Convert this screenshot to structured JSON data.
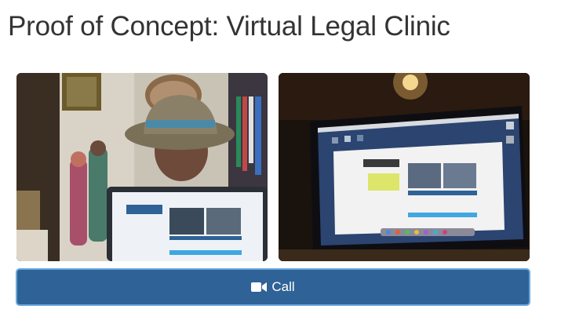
{
  "header": {
    "title": "Proof of Concept: Virtual Legal Clinic"
  },
  "videos": {
    "local": {
      "screen_title": "Proof of Concept: Virtual Legal Clinic"
    },
    "remote": {
      "screen_title": "Proof of Concept: Virtual Legal Clinic"
    }
  },
  "call": {
    "label": "Call",
    "icon": "video-camera-icon"
  },
  "colors": {
    "call_button_bg": "#2f6297",
    "call_button_border": "#6aa8de",
    "title_text": "#333333"
  }
}
